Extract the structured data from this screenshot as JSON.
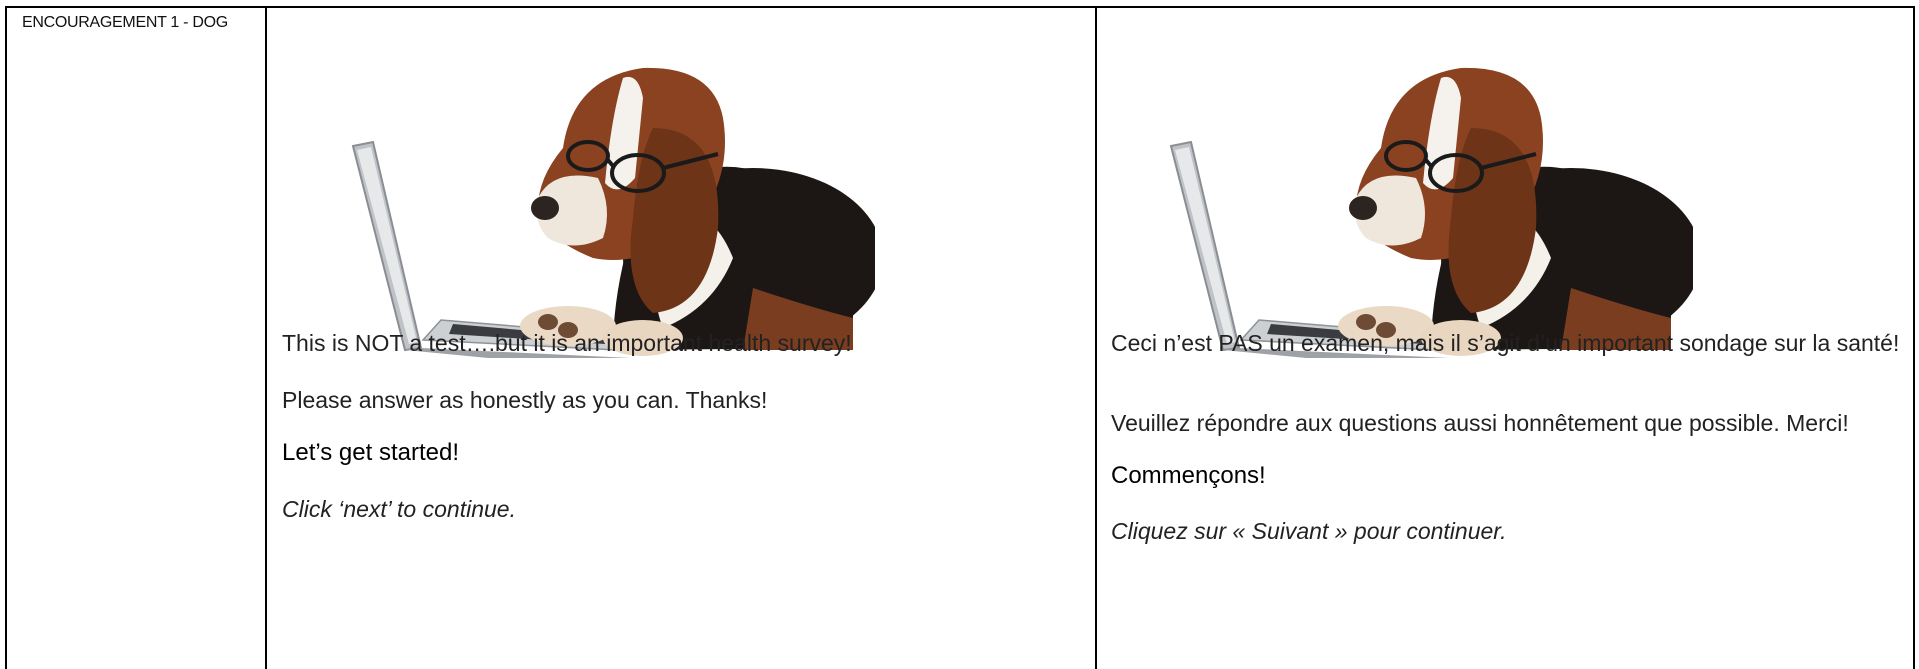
{
  "row_label": "ENCOURAGEMENT 1 - DOG",
  "english": {
    "line1": "This is NOT a test….but it is an important health survey!",
    "line2": "Please answer as honestly as you can. Thanks!",
    "heading": "Let’s get started!",
    "instruction": "Click ‘next’ to continue."
  },
  "french": {
    "line1": "Ceci n’est PAS un examen, mais il s’agit d’un important sondage sur la santé!",
    "line2": "Veuillez répondre aux questions aussi honnêtement que possible. Merci!",
    "heading": "Commençons!",
    "instruction": "Cliquez sur « Suivant » pour continuer."
  }
}
